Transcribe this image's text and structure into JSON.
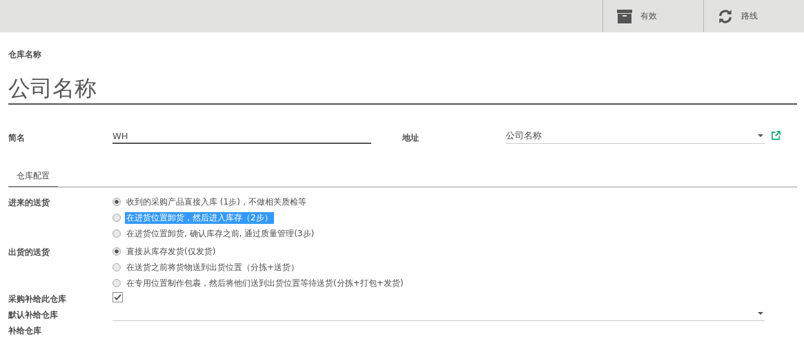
{
  "toolbar": {
    "buttons": [
      {
        "kind": "archive",
        "label": "有效"
      },
      {
        "kind": "refresh",
        "label": "路线"
      }
    ]
  },
  "form": {
    "name_label": "仓库名称",
    "name_value": "公司名称",
    "fields": [
      {
        "kind": "text",
        "label": "简名",
        "value": "WH"
      },
      {
        "kind": "select",
        "label": "地址",
        "value": "公司名称"
      }
    ]
  },
  "tabs": [
    {
      "label": "仓库配置",
      "selected": true
    }
  ],
  "settings": [
    {
      "kind": "radio",
      "label": "进来的送货",
      "options": [
        {
          "text": "收到的采购产品直接入库 (1步)，不做相关质检等",
          "selected": true,
          "highlighted": false
        },
        {
          "text": "在进货位置卸货，然后进入库存（2步）",
          "selected": false,
          "highlighted": true
        },
        {
          "text": "在进货位置卸货, 确认库存之前, 通过质量管理(3步)",
          "selected": false,
          "highlighted": false
        }
      ]
    },
    {
      "kind": "radio",
      "label": "出货的送货",
      "options": [
        {
          "text": "直接从库存发货(仅发货)",
          "selected": true,
          "highlighted": false
        },
        {
          "text": "在送货之前将货物送到出货位置（分拣+送货）",
          "selected": false,
          "highlighted": false
        },
        {
          "text": "在专用位置制作包裹，然后将他们送到出货位置等待送货(分拣+打包+发货)",
          "selected": false,
          "highlighted": false
        }
      ]
    },
    {
      "kind": "checkbox",
      "label": "采购补给此仓库",
      "checked": true
    },
    {
      "kind": "select",
      "label": "默认补给仓库"
    },
    {
      "kind": "empty",
      "label": "补给仓库"
    }
  ]
}
